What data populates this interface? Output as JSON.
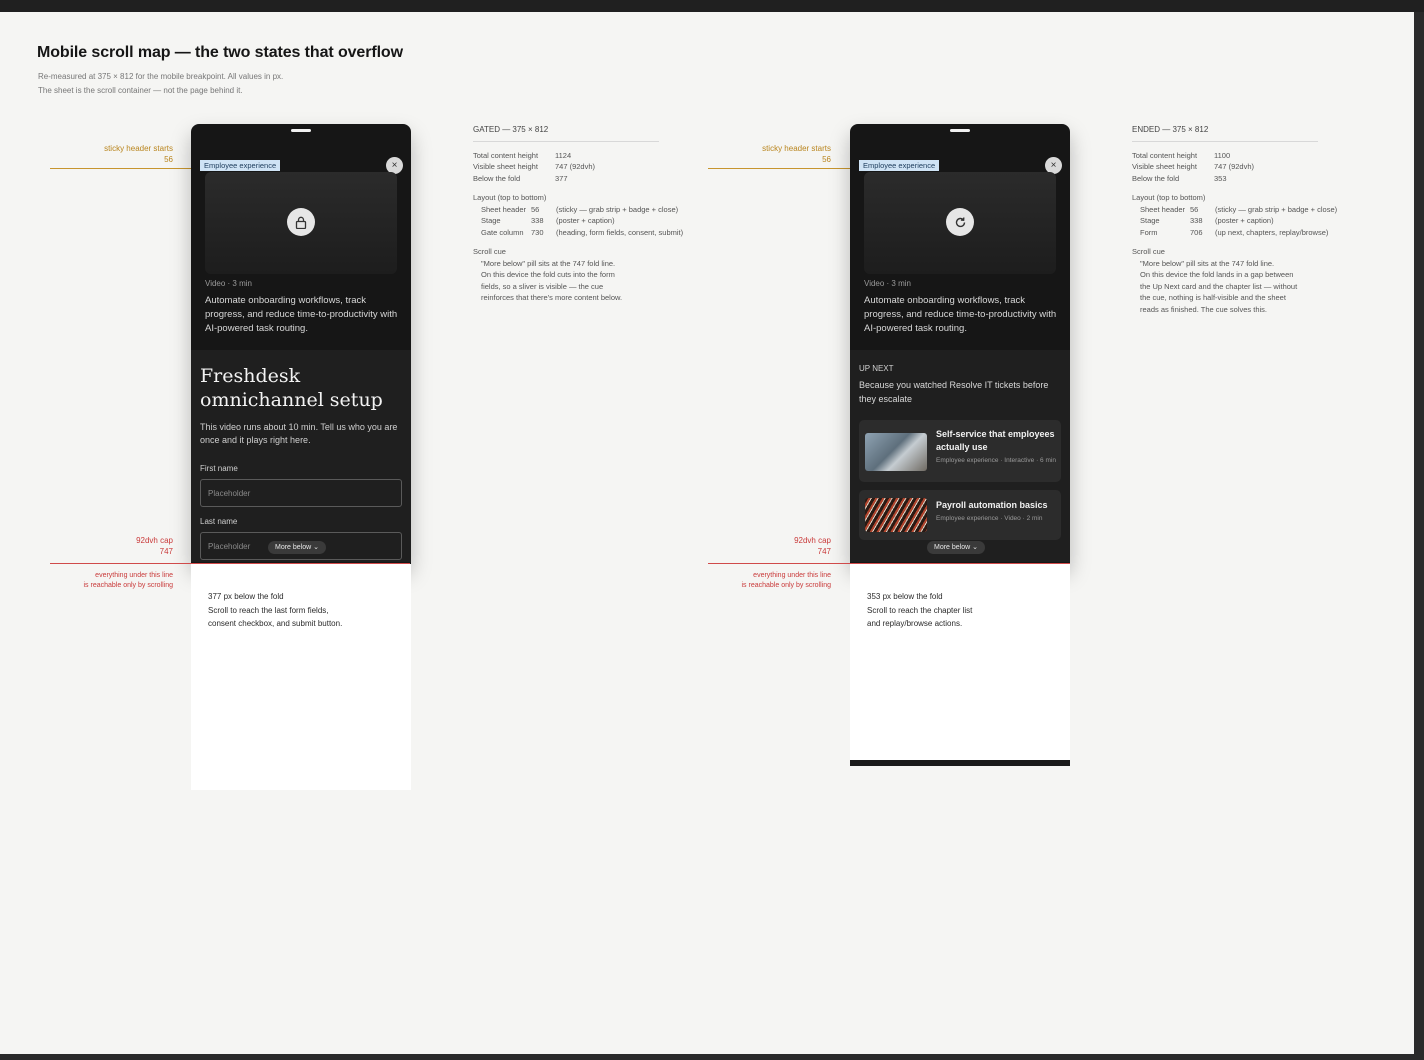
{
  "title": "Mobile scroll map — the two states that overflow",
  "subtitle_lines": [
    "Re-measured at 375 × 812 for the mobile breakpoint. All values in px.",
    "The sheet is the scroll container — not the page behind it."
  ],
  "annotations": {
    "sticky_label": "sticky header starts",
    "sticky_value": "56",
    "cap_label": "92dvh cap",
    "cap_value": "747",
    "below_note_1": "everything under this line",
    "below_note_2": "is reachable only by scrolling"
  },
  "gated": {
    "badge": "Employee experience",
    "close": "×",
    "icon": "lock-icon",
    "meta": "Video · 3 min",
    "description": "Automate onboarding workflows, track progress, and reduce time-to-productivity with AI-powered task routing.",
    "gate_title": "Freshdesk omnichannel setup",
    "gate_sub": "This video runs about 10 min. Tell us who you are once and it plays right here.",
    "first_name_label": "First name",
    "first_name_placeholder": "Placeholder",
    "last_name_label": "Last name",
    "last_name_placeholder": "Placeholder",
    "more_below": "More below",
    "below_px": "377 px below the fold",
    "below_line_1": "Scroll to reach the last form fields,",
    "below_line_2": "consent checkbox, and submit button."
  },
  "ended": {
    "badge": "Employee experience",
    "close": "×",
    "icon": "replay-icon",
    "meta": "Video · 3 min",
    "description": "Automate onboarding workflows, track progress, and reduce time-to-productivity with AI-powered task routing.",
    "upnext_label": "UP NEXT",
    "upnext_text": "Because you watched Resolve IT tickets before they escalate",
    "cards": [
      {
        "title": "Self-service that employees actually use",
        "meta": "Employee experience · Interactive · 6 min"
      },
      {
        "title": "Payroll automation basics",
        "meta": "Employee experience · Video · 2 min"
      }
    ],
    "more_below": "More below",
    "below_px": "353 px below the fold",
    "below_line_1": "Scroll to reach the chapter list",
    "below_line_2": "and replay/browse actions."
  },
  "gated_spec": {
    "head": "GATED — 375 × 812",
    "rows": [
      {
        "k": "Total content height",
        "v": "1124"
      },
      {
        "k": "Visible sheet height",
        "v": "747  (92dvh)"
      },
      {
        "k": "Below the fold",
        "v": "377"
      }
    ],
    "layout_head": "Layout (top to bottom)",
    "layout": [
      {
        "k": "Sheet header",
        "n": "56",
        "d": "(sticky — grab strip + badge + close)"
      },
      {
        "k": "Stage",
        "n": "338",
        "d": "(poster + caption)"
      },
      {
        "k": "Gate column",
        "n": "730",
        "d": "(heading, form fields, consent, submit)"
      }
    ],
    "cue_head": "Scroll cue",
    "cue_lines": [
      "\"More below\" pill sits at the 747 fold line.",
      "On this device the fold cuts into the form",
      "fields, so a sliver is visible — the cue",
      "reinforces that there's more content below."
    ]
  },
  "ended_spec": {
    "head": "ENDED — 375 × 812",
    "rows": [
      {
        "k": "Total content height",
        "v": "1100"
      },
      {
        "k": "Visible sheet height",
        "v": "747  (92dvh)"
      },
      {
        "k": "Below the fold",
        "v": "353"
      }
    ],
    "layout_head": "Layout (top to bottom)",
    "layout": [
      {
        "k": "Sheet header",
        "n": "56",
        "d": "(sticky — grab strip + badge + close)"
      },
      {
        "k": "Stage",
        "n": "338",
        "d": "(poster + caption)"
      },
      {
        "k": "Form",
        "n": "706",
        "d": "(up next, chapters, replay/browse)"
      }
    ],
    "cue_head": "Scroll cue",
    "cue_lines": [
      "\"More below\" pill sits at the 747 fold line.",
      "On this device the fold lands in a gap between",
      "the Up Next card and the chapter list — without",
      "the cue, nothing is half-visible and the sheet",
      "reads as finished. The cue solves this."
    ]
  }
}
